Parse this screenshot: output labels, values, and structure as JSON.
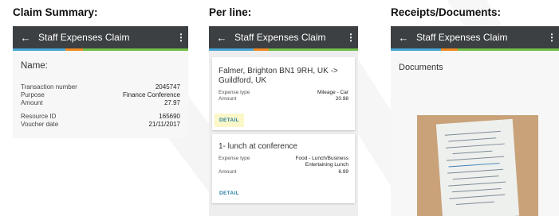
{
  "panels": {
    "claim_summary": {
      "heading": "Claim Summary:",
      "appbar": {
        "back_icon": "←",
        "title": "Staff Expenses Claim",
        "menu_icon": "⋮"
      },
      "name_label": "Name:",
      "fields": [
        {
          "label": "Transaction number",
          "value": "2045747"
        },
        {
          "label": "Purpose",
          "value": "Finance Conference"
        },
        {
          "label": "Amount",
          "value": "27.97"
        },
        {
          "label": "Resource ID",
          "value": "165690"
        },
        {
          "label": "Voucher date",
          "value": "21/11/2017"
        }
      ]
    },
    "per_line": {
      "heading": "Per line:",
      "appbar": {
        "back_icon": "←",
        "title": "Staff Expenses Claim",
        "menu_icon": "⋮"
      },
      "cards": [
        {
          "title": "Falmer, Brighton BN1 9RH, UK -> Guildford, UK",
          "expense_type_label": "Expense type",
          "expense_type_value": "Mileage - Car",
          "amount_label": "Amount",
          "amount_value": "20.98",
          "detail_label": "DETAIL"
        },
        {
          "title": "1- lunch at conference",
          "expense_type_label": "Expense type",
          "expense_type_value": "Food - Lunch/Business Entertaining Lunch",
          "amount_label": "Amount",
          "amount_value": "6.99",
          "detail_label": "DETAIL"
        }
      ]
    },
    "documents": {
      "heading": "Receipts/Documents:",
      "appbar": {
        "back_icon": "←",
        "title": "Staff Expenses Claim",
        "menu_icon": "⋮"
      },
      "documents_label": "Documents"
    }
  },
  "colors": {
    "appbar": "#3c4043",
    "accent_green": "#6fbf4a",
    "accent_orange": "#f08a24",
    "accent_blue": "#4aa7d6",
    "detail_link": "#2a7fa6",
    "detail_highlight": "#fbf7c8"
  }
}
